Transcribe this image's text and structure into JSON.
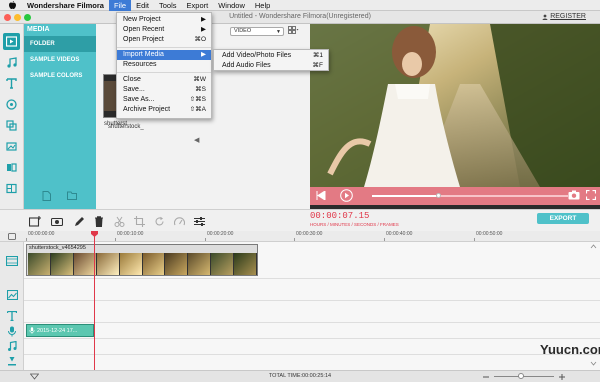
{
  "menubar": {
    "app_name": "Wondershare Filmora",
    "items": [
      "File",
      "Edit",
      "Tools",
      "Export",
      "Window",
      "Help"
    ]
  },
  "window": {
    "title": "Untitled - Wondershare Filmora(Unregistered)",
    "register_label": "REGISTER"
  },
  "media_panel": {
    "header": "MEDIA",
    "categories": [
      "FOLDER",
      "SAMPLE VIDEOS",
      "SAMPLE COLORS"
    ]
  },
  "library": {
    "filter_value": "VIDEO",
    "thumbnail_labels": [
      "shutterst",
      "shutterstock_"
    ]
  },
  "file_menu": {
    "items": [
      {
        "label": "New Project",
        "shortcut": "▶"
      },
      {
        "label": "Open Recent",
        "shortcut": "▶"
      },
      {
        "label": "Open Project",
        "shortcut": "⌘O"
      },
      {
        "label": "Import Media",
        "shortcut": "▶"
      },
      {
        "label": "Resources",
        "shortcut": ""
      },
      {
        "label": "Close",
        "shortcut": "⌘W"
      },
      {
        "label": "Save...",
        "shortcut": "⌘S"
      },
      {
        "label": "Save As...",
        "shortcut": "⇧⌘S"
      },
      {
        "label": "Archive Project",
        "shortcut": "⇧⌘A"
      }
    ]
  },
  "import_submenu": {
    "items": [
      {
        "label": "Add Video/Photo Files",
        "shortcut": "⌘1"
      },
      {
        "label": "Add Audio Files",
        "shortcut": "⌘F"
      }
    ]
  },
  "timeline": {
    "timecode": "00:00:07.15",
    "timecode_caption": "HOURS / MINUTES / SECONDS / FRAMES",
    "export_label": "EXPORT",
    "ruler_labels": [
      "00:00:00:00",
      "00:00:10:00",
      "00:00:20:00",
      "00:00:30:00",
      "00:00:40:00",
      "00:00:50:00"
    ],
    "video_clip_label": "shutterstock_v4654295",
    "audio_clip_label": "2015-12-24 17...",
    "total_time": "TOTAL TIME:00:00:25:14",
    "playback_progress": 0.34
  },
  "watermark": "Yuucn.com",
  "colors": {
    "accent": "#4fc1c9",
    "menu_highlight": "#3d7bd6",
    "timecode": "#e0384a",
    "control_bar": "#e37a84"
  }
}
